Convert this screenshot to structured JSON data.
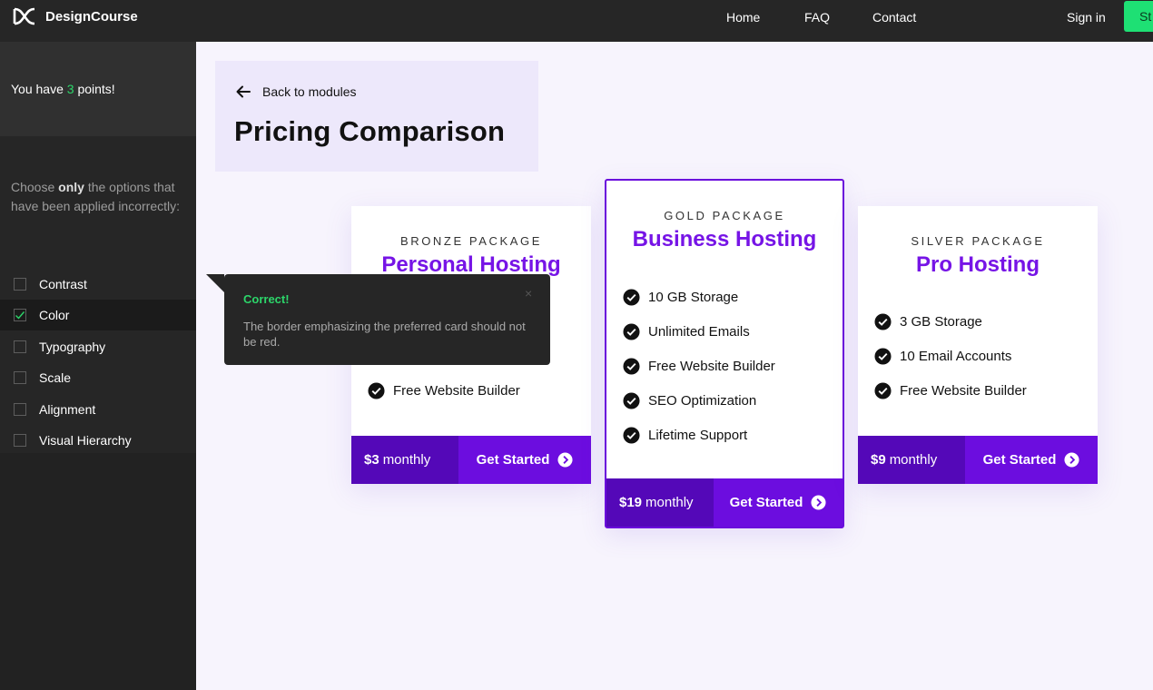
{
  "brand": {
    "name": "DesignCourse",
    "logo_icon": "dc-logo-icon"
  },
  "nav": {
    "links": [
      "Home",
      "FAQ",
      "Contact"
    ],
    "sign_in": "Sign in",
    "cta_partial": "St"
  },
  "sidebar": {
    "points_prefix": "You have ",
    "points": "3",
    "points_suffix": " points!",
    "prompt_before": "Choose ",
    "prompt_bold": "only",
    "prompt_after": " the options that have been applied incorrectly:",
    "options": [
      {
        "label": "Contrast",
        "checked": false
      },
      {
        "label": "Color",
        "checked": true
      },
      {
        "label": "Typography",
        "checked": false
      },
      {
        "label": "Scale",
        "checked": false
      },
      {
        "label": "Alignment",
        "checked": false
      },
      {
        "label": "Visual Hierarchy",
        "checked": false
      }
    ]
  },
  "module": {
    "back_label": "Back to modules",
    "title": "Pricing Comparison"
  },
  "cards": {
    "bronze": {
      "package": "BRONZE PACKAGE",
      "name": "Personal Hosting",
      "features": [
        "Free Website Builder"
      ],
      "price_amount": "$3",
      "price_period": "monthly",
      "cta": "Get Started"
    },
    "gold": {
      "package": "GOLD PACKAGE",
      "name": "Business Hosting",
      "features": [
        "10 GB Storage",
        "Unlimited Emails",
        "Free Website Builder",
        "SEO Optimization",
        "Lifetime Support"
      ],
      "price_amount": "$19",
      "price_period": "monthly",
      "cta": "Get Started"
    },
    "silver": {
      "package": "SILVER PACKAGE",
      "name": "Pro Hosting",
      "features": [
        "3 GB Storage",
        "10 Email Accounts",
        "Free Website Builder"
      ],
      "price_amount": "$9",
      "price_period": "monthly",
      "cta": "Get Started"
    }
  },
  "feedback": {
    "title": "Correct!",
    "close": "×",
    "message": "The border emphasizing the preferred card should not be red."
  },
  "colors": {
    "accent": "#6c0ddf",
    "price_bg": "#5408b8",
    "success": "#2cd66a",
    "cta_green": "#1ee074"
  }
}
